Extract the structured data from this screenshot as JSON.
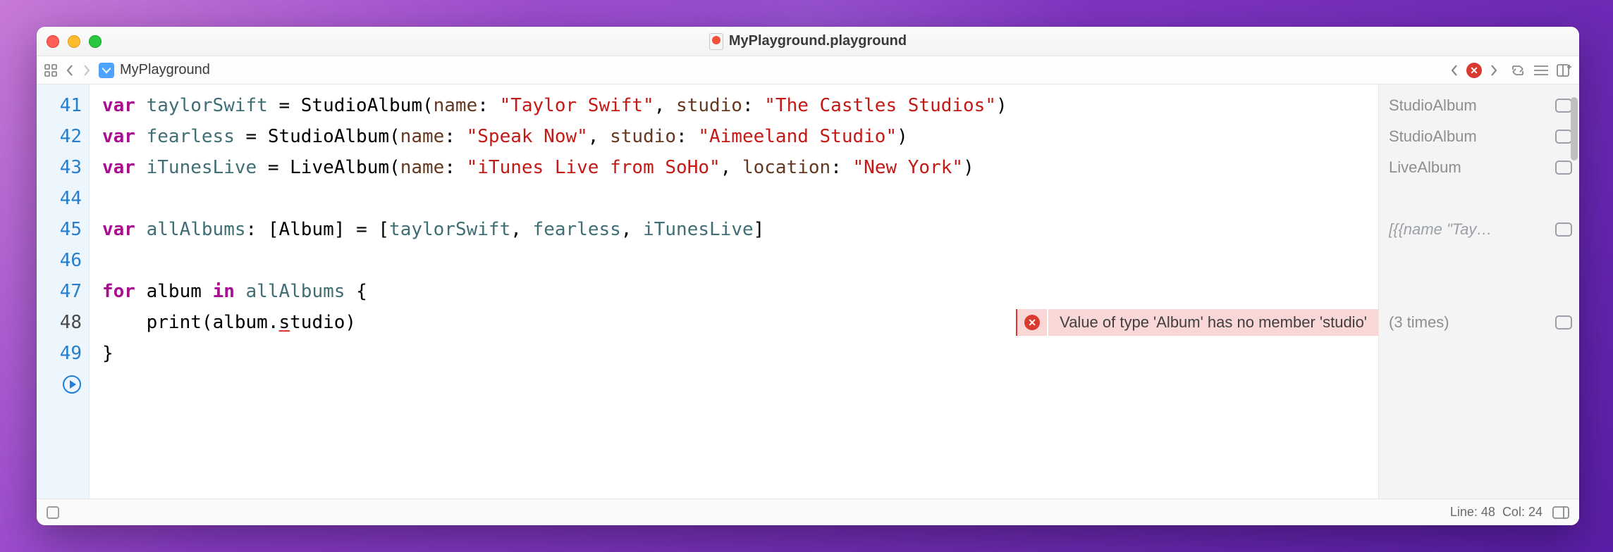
{
  "window": {
    "title": "MyPlayground.playground"
  },
  "breadcrumb": {
    "item": "MyPlayground"
  },
  "code": {
    "lines": [
      {
        "num": 41,
        "tokens": [
          {
            "c": "kw",
            "t": "var"
          },
          {
            "c": "pl",
            "t": " "
          },
          {
            "c": "id",
            "t": "taylorSwift"
          },
          {
            "c": "pl",
            "t": " = "
          },
          {
            "c": "ty",
            "t": "StudioAlbum"
          },
          {
            "c": "pl",
            "t": "("
          },
          {
            "c": "pa",
            "t": "name"
          },
          {
            "c": "pl",
            "t": ": "
          },
          {
            "c": "st",
            "t": "\"Taylor Swift\""
          },
          {
            "c": "pl",
            "t": ", "
          },
          {
            "c": "pa",
            "t": "studio"
          },
          {
            "c": "pl",
            "t": ": "
          },
          {
            "c": "st",
            "t": "\"The Castles Studios\""
          },
          {
            "c": "pl",
            "t": ")"
          }
        ]
      },
      {
        "num": 42,
        "tokens": [
          {
            "c": "kw",
            "t": "var"
          },
          {
            "c": "pl",
            "t": " "
          },
          {
            "c": "id",
            "t": "fearless"
          },
          {
            "c": "pl",
            "t": " = "
          },
          {
            "c": "ty",
            "t": "StudioAlbum"
          },
          {
            "c": "pl",
            "t": "("
          },
          {
            "c": "pa",
            "t": "name"
          },
          {
            "c": "pl",
            "t": ": "
          },
          {
            "c": "st",
            "t": "\"Speak Now\""
          },
          {
            "c": "pl",
            "t": ", "
          },
          {
            "c": "pa",
            "t": "studio"
          },
          {
            "c": "pl",
            "t": ": "
          },
          {
            "c": "st",
            "t": "\"Aimeeland Studio\""
          },
          {
            "c": "pl",
            "t": ")"
          }
        ]
      },
      {
        "num": 43,
        "tokens": [
          {
            "c": "kw",
            "t": "var"
          },
          {
            "c": "pl",
            "t": " "
          },
          {
            "c": "id",
            "t": "iTunesLive"
          },
          {
            "c": "pl",
            "t": " = "
          },
          {
            "c": "ty",
            "t": "LiveAlbum"
          },
          {
            "c": "pl",
            "t": "("
          },
          {
            "c": "pa",
            "t": "name"
          },
          {
            "c": "pl",
            "t": ": "
          },
          {
            "c": "st",
            "t": "\"iTunes Live from SoHo\""
          },
          {
            "c": "pl",
            "t": ", "
          },
          {
            "c": "pa",
            "t": "location"
          },
          {
            "c": "pl",
            "t": ": "
          },
          {
            "c": "st",
            "t": "\"New York\""
          },
          {
            "c": "pl",
            "t": ")"
          }
        ]
      },
      {
        "num": 44,
        "tokens": []
      },
      {
        "num": 45,
        "tokens": [
          {
            "c": "kw",
            "t": "var"
          },
          {
            "c": "pl",
            "t": " "
          },
          {
            "c": "id",
            "t": "allAlbums"
          },
          {
            "c": "pl",
            "t": ": ["
          },
          {
            "c": "ty",
            "t": "Album"
          },
          {
            "c": "pl",
            "t": "] = ["
          },
          {
            "c": "id",
            "t": "taylorSwift"
          },
          {
            "c": "pl",
            "t": ", "
          },
          {
            "c": "id",
            "t": "fearless"
          },
          {
            "c": "pl",
            "t": ", "
          },
          {
            "c": "id",
            "t": "iTunesLive"
          },
          {
            "c": "pl",
            "t": "]"
          }
        ]
      },
      {
        "num": 46,
        "tokens": []
      },
      {
        "num": 47,
        "tokens": [
          {
            "c": "kw",
            "t": "for"
          },
          {
            "c": "pl",
            "t": " "
          },
          {
            "c": "pl",
            "t": "album"
          },
          {
            "c": "pl",
            "t": " "
          },
          {
            "c": "kw",
            "t": "in"
          },
          {
            "c": "pl",
            "t": " "
          },
          {
            "c": "id",
            "t": "allAlbums"
          },
          {
            "c": "pl",
            "t": " {"
          }
        ]
      },
      {
        "num": 48,
        "err": true,
        "tokens": [
          {
            "c": "pl",
            "t": "    "
          },
          {
            "c": "ty",
            "t": "print"
          },
          {
            "c": "pl",
            "t": "("
          },
          {
            "c": "pl",
            "t": "album."
          },
          {
            "c": "pl",
            "t": "s",
            "u": true
          },
          {
            "c": "pl",
            "t": "tudio)"
          }
        ]
      },
      {
        "num": 49,
        "tokens": [
          {
            "c": "pl",
            "t": "}"
          }
        ]
      }
    ]
  },
  "error": {
    "message": "Value of type 'Album' has no member 'studio'"
  },
  "results": [
    {
      "line": 41,
      "text": "StudioAlbum",
      "style": "solid"
    },
    {
      "line": 42,
      "text": "StudioAlbum",
      "style": "solid"
    },
    {
      "line": 43,
      "text": "LiveAlbum",
      "style": "solid"
    },
    {
      "line": 44,
      "text": ""
    },
    {
      "line": 45,
      "text": "[{{name \"Tay…",
      "style": "italic"
    },
    {
      "line": 46,
      "text": ""
    },
    {
      "line": 47,
      "text": ""
    },
    {
      "line": 48,
      "text": "(3 times)",
      "style": "solid"
    },
    {
      "line": 49,
      "text": ""
    }
  ],
  "status": {
    "line": 48,
    "col": 24,
    "line_label": "Line:",
    "col_label": "Col:"
  }
}
